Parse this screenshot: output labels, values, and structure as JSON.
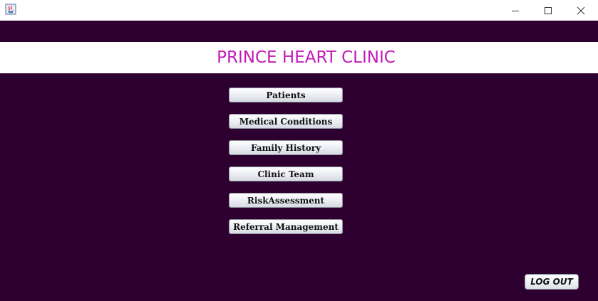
{
  "window": {
    "icons": {
      "app": "java-app-icon",
      "minimize": "minimize-icon",
      "maximize": "maximize-icon",
      "close": "close-icon"
    }
  },
  "header": {
    "title": "PRINCE HEART CLINIC"
  },
  "menu": {
    "patients": "Patients",
    "medical_conditions": "Medical Conditions",
    "family_history": "Family History",
    "clinic_team": "Clinic Team",
    "risk_assessment": "RiskAssessment",
    "referral_management": "Referral Management"
  },
  "actions": {
    "logout": "LOG OUT"
  },
  "colors": {
    "background": "#2e0030",
    "title": "#c21ab8",
    "header_band": "#ffffff"
  }
}
